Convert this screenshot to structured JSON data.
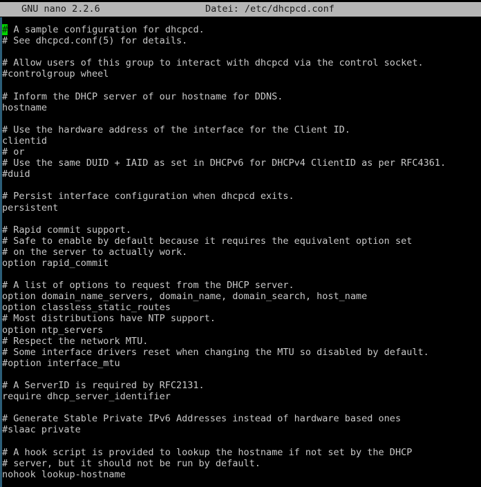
{
  "editor": {
    "app_name": "GNU nano 2.2.6",
    "file_label": "Datei: /etc/dhcpcd.conf",
    "colors": {
      "background": "#000000",
      "foreground": "#c9c9c9",
      "titlebar_bg": "#b6b6b6",
      "titlebar_fg": "#1a1a1a",
      "cursor_bg": "#00d400",
      "cursor_fg": "#0a2a0a",
      "left_rail": "#2b5d78"
    },
    "cursor": {
      "row": 1,
      "column": 1,
      "char": "#"
    }
  },
  "buffer": {
    "lines": [
      "# A sample configuration for dhcpcd.",
      "# See dhcpcd.conf(5) for details.",
      "",
      "# Allow users of this group to interact with dhcpcd via the control socket.",
      "#controlgroup wheel",
      "",
      "# Inform the DHCP server of our hostname for DDNS.",
      "hostname",
      "",
      "# Use the hardware address of the interface for the Client ID.",
      "clientid",
      "# or",
      "# Use the same DUID + IAID as set in DHCPv6 for DHCPv4 ClientID as per RFC4361.",
      "#duid",
      "",
      "# Persist interface configuration when dhcpcd exits.",
      "persistent",
      "",
      "# Rapid commit support.",
      "# Safe to enable by default because it requires the equivalent option set",
      "# on the server to actually work.",
      "option rapid_commit",
      "",
      "# A list of options to request from the DHCP server.",
      "option domain_name_servers, domain_name, domain_search, host_name",
      "option classless_static_routes",
      "# Most distributions have NTP support.",
      "option ntp_servers",
      "# Respect the network MTU.",
      "# Some interface drivers reset when changing the MTU so disabled by default.",
      "#option interface_mtu",
      "",
      "# A ServerID is required by RFC2131.",
      "require dhcp_server_identifier",
      "",
      "# Generate Stable Private IPv6 Addresses instead of hardware based ones",
      "#slaac private",
      "",
      "# A hook script is provided to lookup the hostname if not set by the DHCP",
      "# server, but it should not be run by default.",
      "nohook lookup-hostname",
      ""
    ],
    "first_line_cursor_char": "#",
    "first_line_rest": " A sample configuration for dhcpcd."
  }
}
